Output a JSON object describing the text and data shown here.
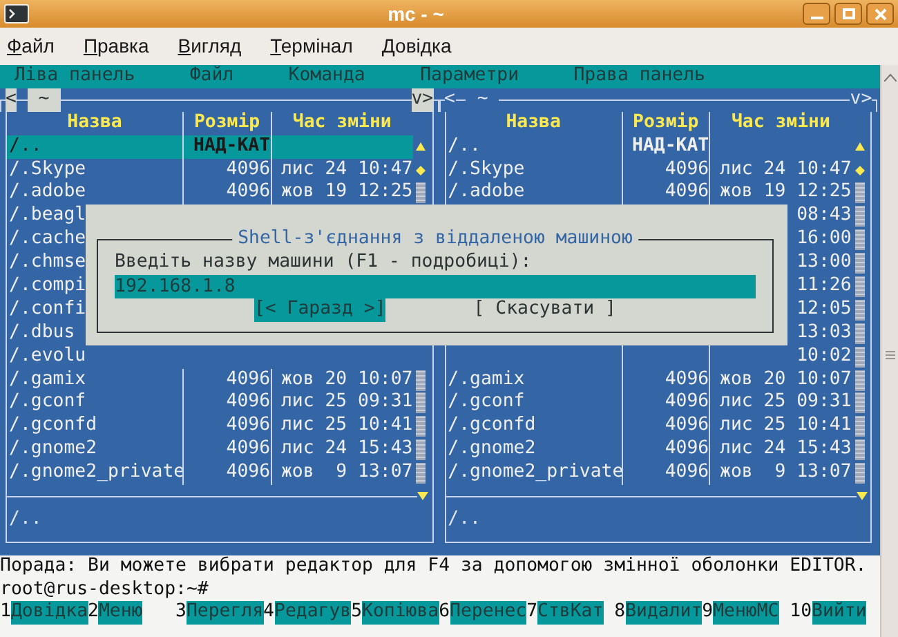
{
  "window": {
    "title": "mc - ~"
  },
  "menubar": [
    "Файл",
    "Правка",
    "Вигляд",
    "Термінал",
    "Довідка"
  ],
  "mc_menu": [
    "Ліва панель",
    "Файл",
    "Команда",
    "Параметри",
    "Права панель"
  ],
  "panels": [
    {
      "active": true,
      "history_prev": "<",
      "path": "~",
      "history_next": "v>",
      "columns": [
        "Назва",
        "Розмір",
        "Час зміни"
      ],
      "status": "/..",
      "rows": [
        {
          "name": "/..",
          "size": "НАД-КАТ",
          "selected": true
        },
        {
          "name": "/.Skype",
          "size": "4096",
          "time": "лис 24 10:47",
          "selected": false
        },
        {
          "name": "/.adobe",
          "size": "4096",
          "time": "жов 19 12:25",
          "selected": false
        },
        {
          "name": "/.beagl",
          "selected": false
        },
        {
          "name": "/.cache",
          "selected": false
        },
        {
          "name": "/.chmse",
          "selected": false
        },
        {
          "name": "/.compi",
          "selected": false
        },
        {
          "name": "/.confi",
          "selected": false
        },
        {
          "name": "/.dbus",
          "selected": false
        },
        {
          "name": "/.evolu",
          "selected": false
        },
        {
          "name": "/.gamix",
          "size": "4096",
          "time": "жов 20 10:07",
          "selected": false
        },
        {
          "name": "/.gconf",
          "size": "4096",
          "time": "лис 25 09:31",
          "selected": false
        },
        {
          "name": "/.gconfd",
          "size": "4096",
          "time": "лис 25 10:41",
          "selected": false
        },
        {
          "name": "/.gnome2",
          "size": "4096",
          "time": "лис 24 15:43",
          "selected": false
        },
        {
          "name": "/.gnome2_private",
          "size": "4096",
          "time": "жов  9 13:07",
          "selected": false
        }
      ]
    },
    {
      "active": false,
      "history_prev": "<",
      "path": "~",
      "history_next": "v>",
      "columns": [
        "Назва",
        "Розмір",
        "Час зміни"
      ],
      "status": "/..",
      "rows": [
        {
          "name": "/..",
          "size": "НАД-КАТ",
          "selected": false
        },
        {
          "name": "/.Skype",
          "size": "4096",
          "time": "лис 24 10:47",
          "selected": false
        },
        {
          "name": "/.adobe",
          "size": "4096",
          "time": "жов 19 12:25",
          "selected": false
        },
        {
          "time": "08:43"
        },
        {
          "time": "16:00"
        },
        {
          "time": "13:00"
        },
        {
          "time": "11:26"
        },
        {
          "time": "12:05"
        },
        {
          "time": "13:03"
        },
        {
          "time": "10:02"
        },
        {
          "name": "/.gamix",
          "size": "4096",
          "time": "жов 20 10:07",
          "selected": false
        },
        {
          "name": "/.gconf",
          "size": "4096",
          "time": "лис 25 09:31",
          "selected": false
        },
        {
          "name": "/.gconfd",
          "size": "4096",
          "time": "лис 25 10:41",
          "selected": false
        },
        {
          "name": "/.gnome2",
          "size": "4096",
          "time": "лис 24 15:43",
          "selected": false
        },
        {
          "name": "/.gnome2_private",
          "size": "4096",
          "time": "жов  9 13:07",
          "selected": false
        }
      ]
    }
  ],
  "dialog": {
    "title": "Shell-з'єднання з віддаленою машиною",
    "label": "Введіть назву машини (F1 - подробиці):",
    "value": "192.168.1.8",
    "buttons": [
      {
        "label": "[< Гаразд >]",
        "selected": true
      },
      {
        "label": "[ Скасувати ]",
        "selected": false
      }
    ]
  },
  "hint": "Порада: Ви можете вибрати редактор для F4 за допомогою змінної оболонки EDITOR.",
  "prompt": "root@rus-desktop:~#",
  "fkeys": [
    {
      "num": "1",
      "label": "Довідка"
    },
    {
      "num": "2",
      "label": "Меню"
    },
    {
      "num": "3",
      "label": "Перегля"
    },
    {
      "num": "4",
      "label": "Редагув"
    },
    {
      "num": "5",
      "label": "Копіюва"
    },
    {
      "num": "6",
      "label": "Перенес"
    },
    {
      "num": "7",
      "label": "СтвКат"
    },
    {
      "num": "8",
      "label": "Видалит"
    },
    {
      "num": "9",
      "label": "МенюМС"
    },
    {
      "num": "10",
      "label": "Вийти"
    }
  ]
}
